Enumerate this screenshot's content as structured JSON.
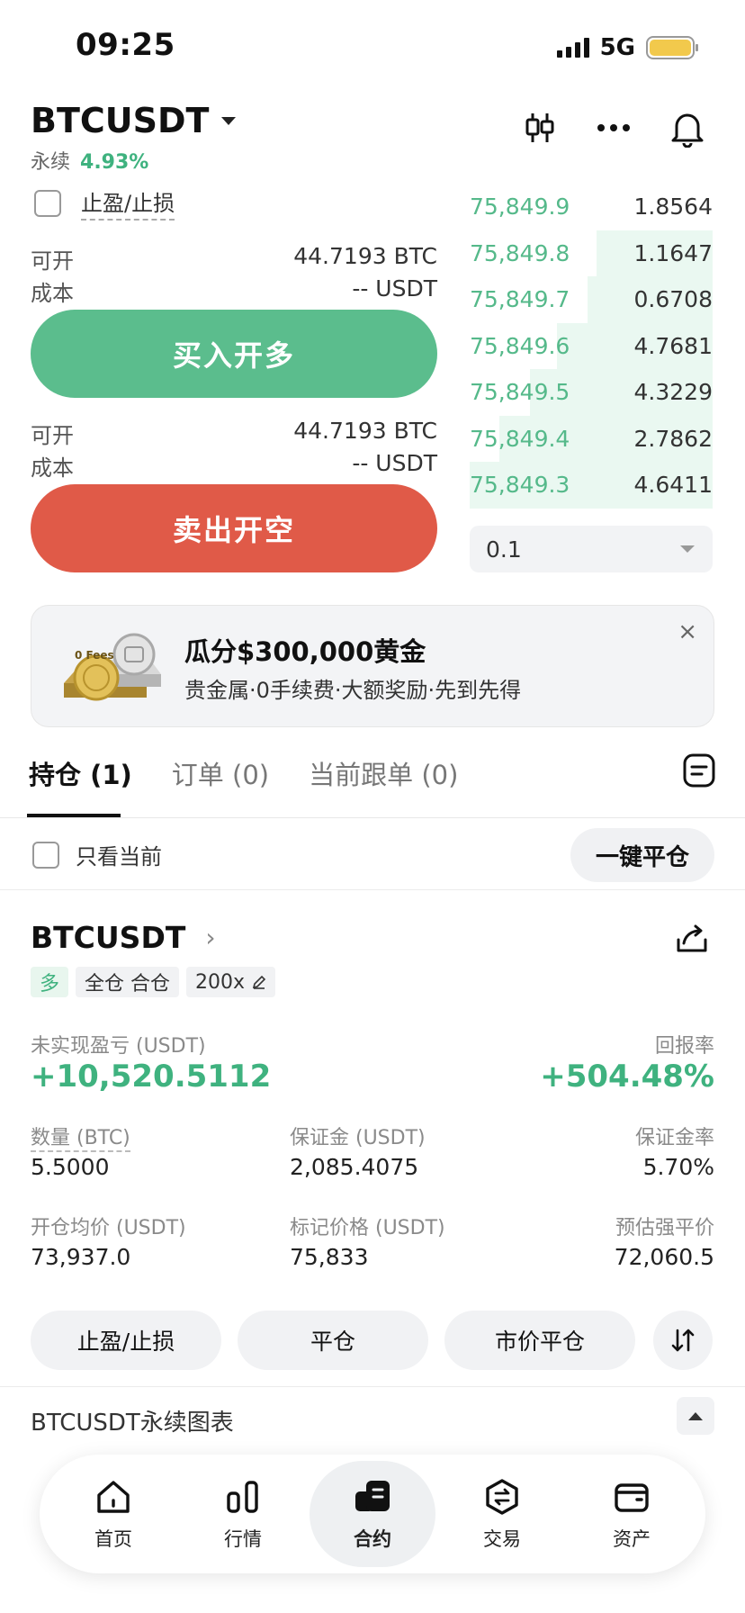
{
  "status_bar": {
    "time": "09:25",
    "network": "5G",
    "battery_color": "#f2c94c"
  },
  "header": {
    "symbol": "BTCUSDT",
    "type_label": "永续",
    "change_pct": "4.93%",
    "icons": [
      "candlestick-icon",
      "more-icon",
      "bell-icon"
    ]
  },
  "order_form": {
    "tpsl_label": "止盈/止损",
    "buy": {
      "avail_label": "可开",
      "avail_value": "44.7193 BTC",
      "cost_label": "成本",
      "cost_value": "-- USDT",
      "button": "买入开多"
    },
    "sell": {
      "avail_label": "可开",
      "avail_value": "44.7193 BTC",
      "cost_label": "成本",
      "cost_value": "-- USDT",
      "button": "卖出开空"
    }
  },
  "order_book": {
    "rows": [
      {
        "price": "75,849.9",
        "qty": "1.8564",
        "depth": 0.0
      },
      {
        "price": "75,849.8",
        "qty": "1.1647",
        "depth": 0.05
      },
      {
        "price": "75,849.7",
        "qty": "0.6708",
        "depth": 0.12
      },
      {
        "price": "75,849.6",
        "qty": "4.7681",
        "depth": 0.35
      },
      {
        "price": "75,849.5",
        "qty": "4.3229",
        "depth": 0.55
      },
      {
        "price": "75,849.4",
        "qty": "2.7862",
        "depth": 0.78
      },
      {
        "price": "75,849.3",
        "qty": "4.6411",
        "depth": 1.0
      }
    ],
    "precision": "0.1"
  },
  "banner": {
    "title": "瓜分$300,000黄金",
    "subtitle": "贵金属·0手续费·大额奖励·先到先得",
    "close": "×",
    "image_text": "0 Fees"
  },
  "tabs": [
    {
      "label": "持仓 (1)",
      "active": true
    },
    {
      "label": "订单 (0)",
      "active": false
    },
    {
      "label": "当前跟单 (0)",
      "active": false
    }
  ],
  "filter": {
    "label": "只看当前",
    "close_all": "一键平仓"
  },
  "position": {
    "symbol": "BTCUSDT",
    "chevron": "›",
    "tags": [
      "多",
      "全仓 合仓",
      "200x"
    ],
    "pnl_label": "未实现盈亏 (USDT)",
    "pnl_value": "+10,520.5112",
    "roe_label": "回报率",
    "roe_value": "+504.48%",
    "grid": [
      {
        "label": "数量 (BTC)",
        "value": "5.5000"
      },
      {
        "label": "保证金 (USDT)",
        "value": "2,085.4075"
      },
      {
        "label": "保证金率",
        "value": "5.70%"
      },
      {
        "label": "开仓均价 (USDT)",
        "value": "73,937.0"
      },
      {
        "label": "标记价格 (USDT)",
        "value": "75,833"
      },
      {
        "label": "预估强平价",
        "value": "72,060.5"
      }
    ],
    "actions": [
      "止盈/止损",
      "平仓",
      "市价平仓"
    ]
  },
  "chart_section": {
    "title": "BTCUSDT永续图表"
  },
  "nav": [
    {
      "label": "首页",
      "icon": "home-icon",
      "active": false
    },
    {
      "label": "行情",
      "icon": "markets-icon",
      "active": false
    },
    {
      "label": "合约",
      "icon": "futures-icon",
      "active": true
    },
    {
      "label": "交易",
      "icon": "trade-icon",
      "active": false
    },
    {
      "label": "资产",
      "icon": "wallet-icon",
      "active": false
    }
  ],
  "colors": {
    "green": "#5bbd8d",
    "red": "#e05a48",
    "text_green": "#3fb27f"
  }
}
